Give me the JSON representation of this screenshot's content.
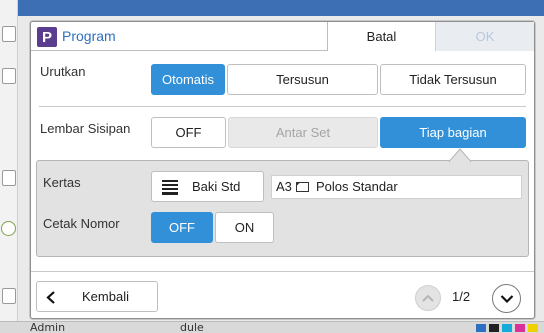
{
  "background": {
    "footer_left": "Admin",
    "footer_mid": "dule"
  },
  "dialog": {
    "title": "Program",
    "app_logo_letter": "P",
    "cancel_label": "Batal",
    "ok_label": "OK"
  },
  "sort": {
    "label": "Urutkan",
    "options": [
      "Otomatis",
      "Tersusun",
      "Tidak Tersusun"
    ],
    "selected": "Otomatis"
  },
  "insert_sheet": {
    "label": "Lembar Sisipan",
    "options": [
      "OFF",
      "Antar Set",
      "Tiap bagian"
    ],
    "selected": "Tiap bagian",
    "disabled": "Antar Set"
  },
  "paper": {
    "label": "Kertas",
    "tray_label": "Baki Std",
    "size": "A3",
    "type": "Polos Standar",
    "icon": "tray-icon"
  },
  "print_number": {
    "label": "Cetak Nomor",
    "options": [
      "OFF",
      "ON"
    ],
    "selected": "OFF"
  },
  "footer": {
    "back_label": "Kembali",
    "page_indicator": "1/2"
  },
  "colors": {
    "accent": "#3290d9",
    "title_blue": "#2f6fbf",
    "logo_purple": "#5a3d8f"
  }
}
